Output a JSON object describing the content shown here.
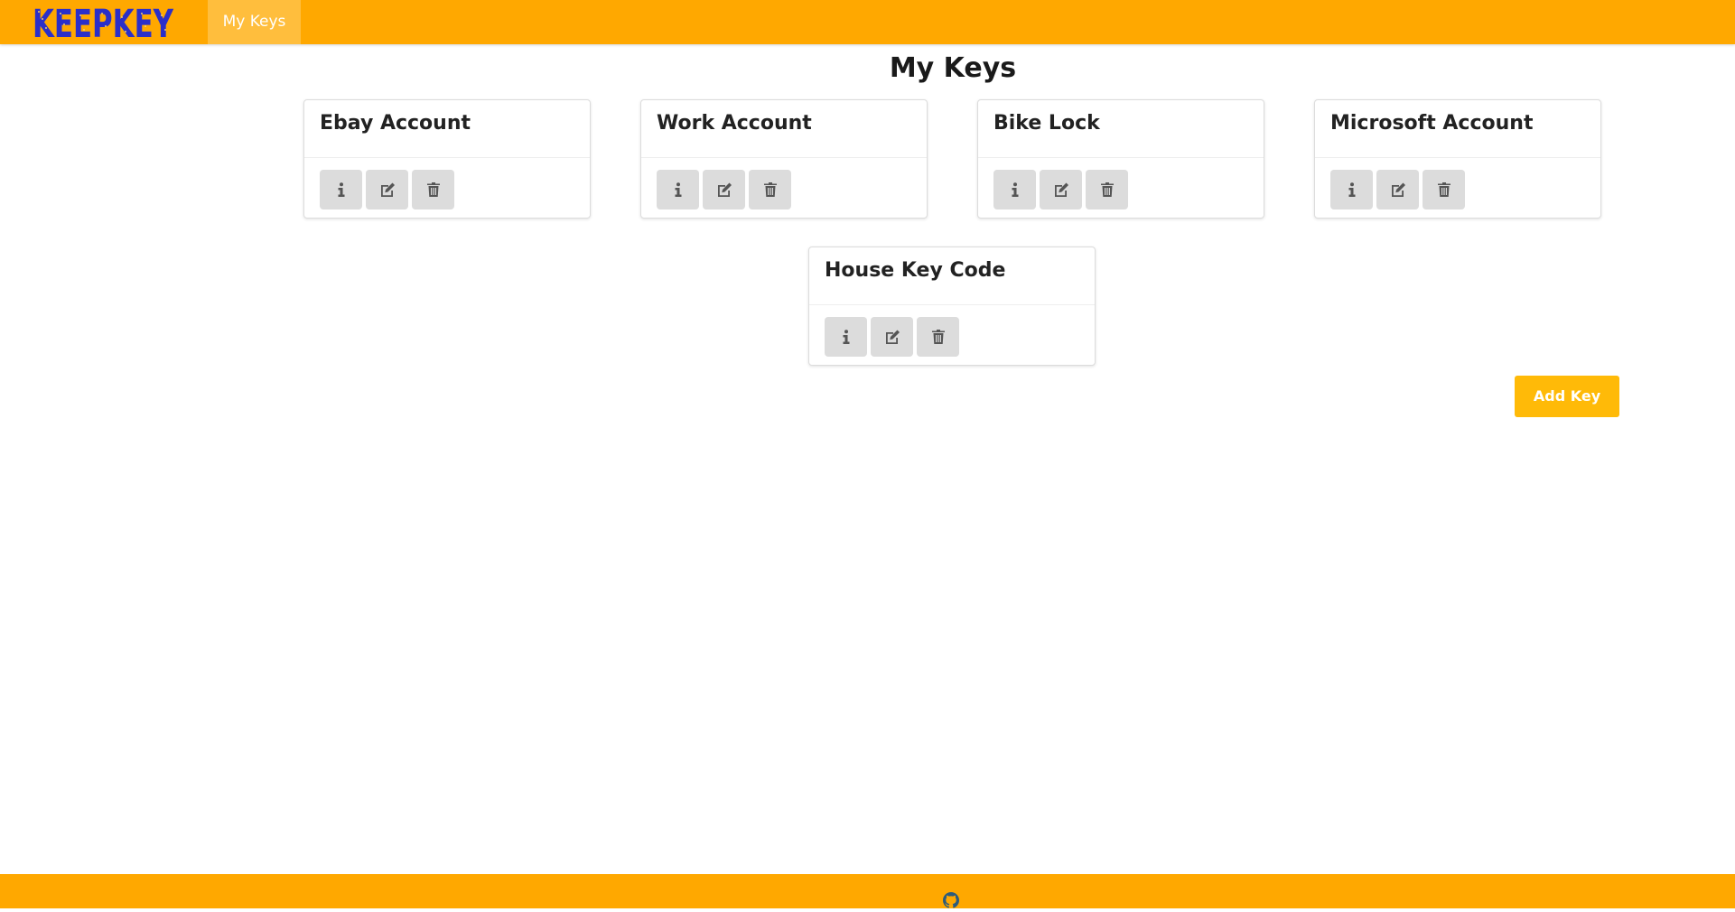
{
  "navbar": {
    "logo_text": "KEEPKEY",
    "nav_item": "My Keys"
  },
  "page": {
    "title": "My Keys"
  },
  "keys": [
    {
      "name": "Ebay Account"
    },
    {
      "name": "Work Account"
    },
    {
      "name": "Bike Lock"
    },
    {
      "name": "Microsoft Account"
    },
    {
      "name": "House Key Code"
    }
  ],
  "actions": {
    "icons": [
      "info-icon",
      "edit-icon",
      "trash-icon"
    ]
  },
  "add_button": {
    "label": "Add Key"
  },
  "footer": {
    "icon": "github-icon"
  },
  "colors": {
    "header": "#ffa800",
    "nav_active": "#ffbe3d",
    "add_button": "#ffba08",
    "logo": "#2b2fc9",
    "action_button": "#dcdcdc"
  }
}
